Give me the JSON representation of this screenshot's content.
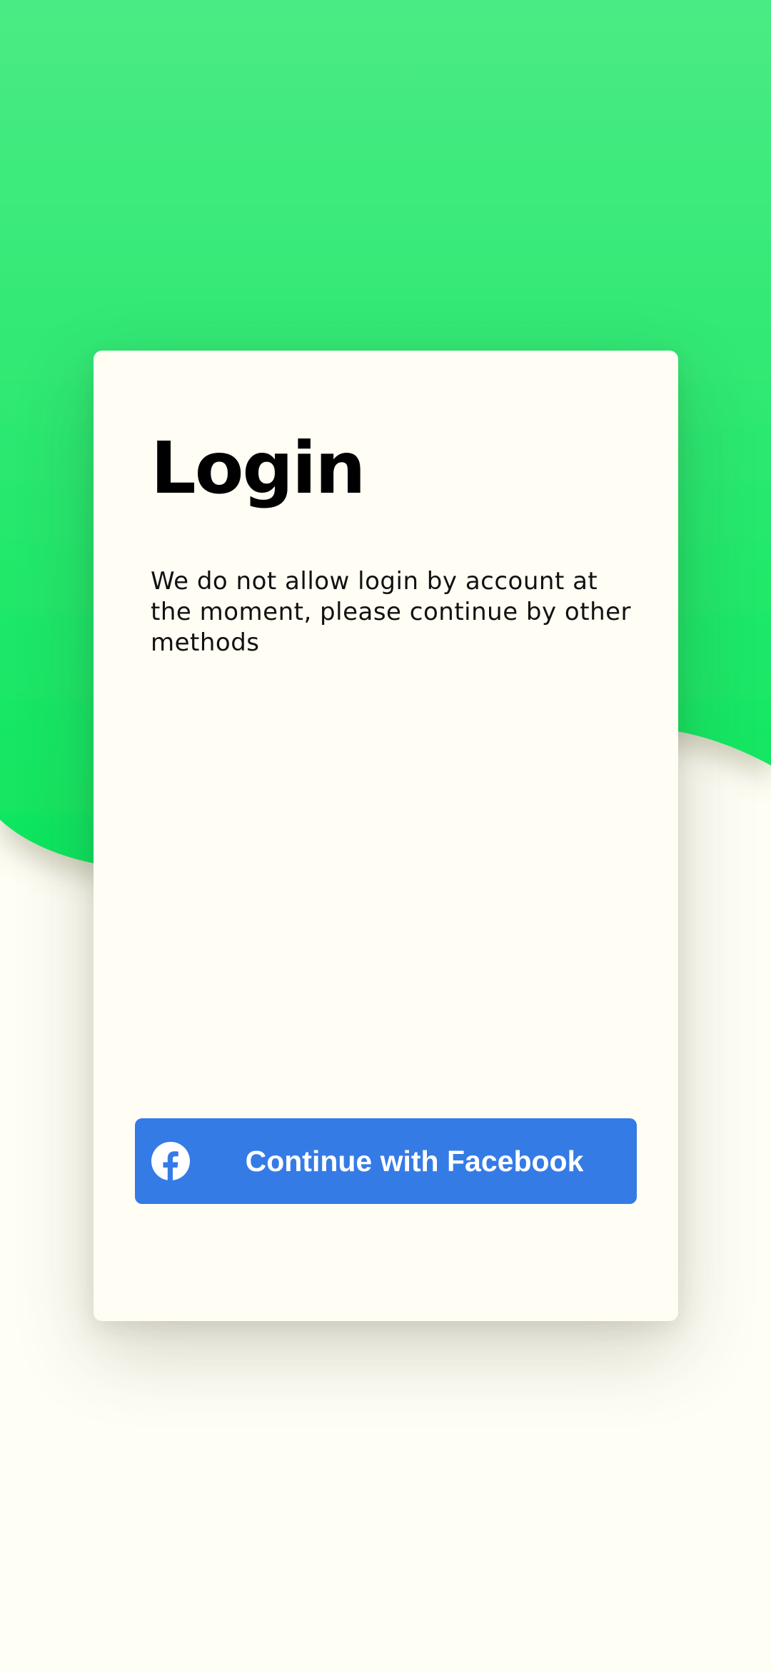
{
  "login": {
    "title": "Login",
    "message": "We do not allow login by account at the moment, please continue by other methods"
  },
  "facebook_button": {
    "label": "Continue with Facebook",
    "icon": "facebook-icon"
  },
  "colors": {
    "background": "#fffef5",
    "card": "#fffdf4",
    "wave_top": "#4aeb84",
    "wave_bottom": "#0ee65e",
    "facebook_blue": "#357be6"
  }
}
